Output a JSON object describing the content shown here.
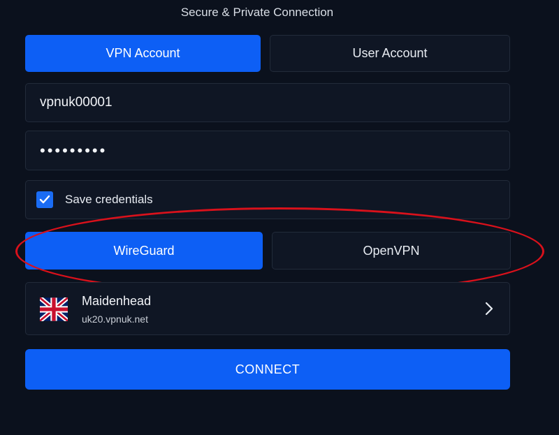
{
  "header": {
    "subtitle": "Secure & Private Connection"
  },
  "account_tabs": {
    "vpn_account": "VPN Account",
    "user_account": "User Account",
    "selected": "vpn_account"
  },
  "login": {
    "username": "vpnuk00001",
    "password_masked": "•••••••••"
  },
  "save_credentials": {
    "label": "Save credentials",
    "checked": true
  },
  "protocols": {
    "wireguard": "WireGuard",
    "openvpn": "OpenVPN",
    "selected": "wireguard"
  },
  "server": {
    "name": "Maidenhead",
    "host": "uk20.vpnuk.net",
    "flag_icon": "uk-flag-icon"
  },
  "connect_label": "CONNECT",
  "colors": {
    "background": "#0b111d",
    "accent": "#0d5ff5",
    "annotation": "#d9111b"
  }
}
